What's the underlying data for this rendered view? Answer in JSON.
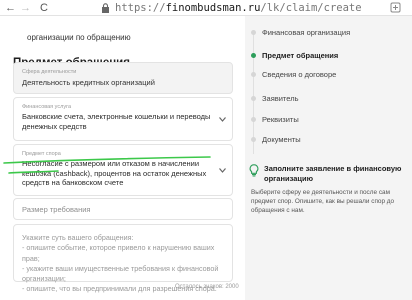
{
  "browser": {
    "url_scheme": "https://",
    "url_host": "finombudsman.ru",
    "url_path": "/lk/claim/create",
    "back_label": "←",
    "forward_label": "→",
    "reload_label": "C"
  },
  "form": {
    "partial_text": "организации по обращению",
    "section_title": "Предмет обращения",
    "activity_field": {
      "label": "Сфера деятельности",
      "value": "Деятельность кредитных организаций"
    },
    "service_field": {
      "label": "Финансовая услуга",
      "value": "Банковские счета, электронные кошельки и переводы денежных средств"
    },
    "dispute_field": {
      "label": "Предмет спора",
      "value": "Несогласие с размером или отказом в начислении кешбэка (cashback), процентов на остаток денежных средств на банковском счете"
    },
    "amount_field": {
      "placeholder": "Размер требования"
    },
    "description_field": {
      "placeholder_lines": [
        "Укажите суть вашего обращения:",
        "- опишите событие, которое привело к нарушению ваших прав;",
        "- укажите ваши имущественные требования к финансовой организации;",
        "- опишите, что вы предпринимали для разрешения спора."
      ]
    },
    "counter_text": "Осталось знаков: 2000"
  },
  "steps": [
    {
      "label": "Финансовая организация",
      "active": false
    },
    {
      "label": "Предмет обращения",
      "active": true
    },
    {
      "label": "Сведения о договоре",
      "active": false
    },
    {
      "label": "Заявитель",
      "active": false
    },
    {
      "label": "Реквизиты",
      "active": false
    },
    {
      "label": "Документы",
      "active": false
    }
  ],
  "tip": {
    "title": "Заполните заявление в финансовую организацию",
    "text": "Выберите сферу ее деятельности и после сам предмет спор. Опишите, как вы решали спор до обращения с нам."
  },
  "colors": {
    "accent_green": "#2e9e5b",
    "highlight_green": "#3cc84a"
  }
}
